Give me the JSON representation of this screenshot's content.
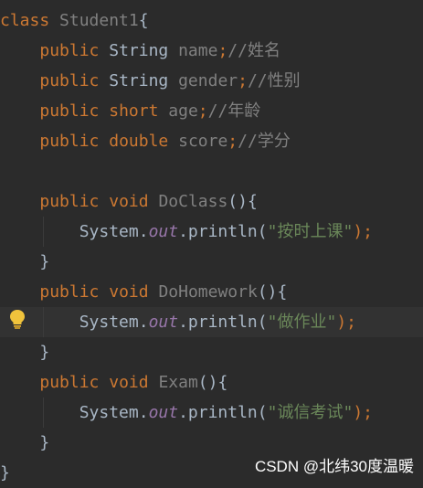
{
  "editor": {
    "lines": [
      {
        "tokens": [
          {
            "t": "class",
            "c": "kw"
          },
          {
            "t": " ",
            "c": ""
          },
          {
            "t": "Student1",
            "c": "unused"
          },
          {
            "t": "{",
            "c": ""
          }
        ]
      },
      {
        "tokens": [
          {
            "t": "    ",
            "c": ""
          },
          {
            "t": "public",
            "c": "kw"
          },
          {
            "t": " String ",
            "c": ""
          },
          {
            "t": "name",
            "c": "unused"
          },
          {
            "t": ";",
            "c": "kw"
          },
          {
            "t": "//姓名",
            "c": "comment"
          }
        ]
      },
      {
        "tokens": [
          {
            "t": "    ",
            "c": ""
          },
          {
            "t": "public",
            "c": "kw"
          },
          {
            "t": " String ",
            "c": ""
          },
          {
            "t": "gender",
            "c": "unused"
          },
          {
            "t": ";",
            "c": "kw"
          },
          {
            "t": "//性别",
            "c": "comment"
          }
        ]
      },
      {
        "tokens": [
          {
            "t": "    ",
            "c": ""
          },
          {
            "t": "public",
            "c": "kw"
          },
          {
            "t": " ",
            "c": ""
          },
          {
            "t": "short",
            "c": "kw"
          },
          {
            "t": " ",
            "c": ""
          },
          {
            "t": "age",
            "c": "unused"
          },
          {
            "t": ";",
            "c": "kw"
          },
          {
            "t": "//年龄",
            "c": "comment"
          }
        ]
      },
      {
        "tokens": [
          {
            "t": "    ",
            "c": ""
          },
          {
            "t": "public",
            "c": "kw"
          },
          {
            "t": " ",
            "c": ""
          },
          {
            "t": "double",
            "c": "kw"
          },
          {
            "t": " ",
            "c": ""
          },
          {
            "t": "score",
            "c": "unused"
          },
          {
            "t": ";",
            "c": "kw"
          },
          {
            "t": "//学分",
            "c": "comment"
          }
        ]
      },
      {
        "tokens": []
      },
      {
        "tokens": [
          {
            "t": "    ",
            "c": ""
          },
          {
            "t": "public",
            "c": "kw"
          },
          {
            "t": " ",
            "c": ""
          },
          {
            "t": "void",
            "c": "kw"
          },
          {
            "t": " ",
            "c": ""
          },
          {
            "t": "DoClass",
            "c": "unused"
          },
          {
            "t": "(){",
            "c": ""
          }
        ]
      },
      {
        "tokens": [
          {
            "t": "        System.",
            "c": ""
          },
          {
            "t": "out",
            "c": "out"
          },
          {
            "t": ".println(",
            "c": ""
          },
          {
            "t": "\"按时上课\"",
            "c": "str"
          },
          {
            "t": ");",
            "c": "kw"
          }
        ]
      },
      {
        "tokens": [
          {
            "t": "    }",
            "c": ""
          }
        ]
      },
      {
        "tokens": [
          {
            "t": "    ",
            "c": ""
          },
          {
            "t": "public",
            "c": "kw"
          },
          {
            "t": " ",
            "c": ""
          },
          {
            "t": "void",
            "c": "kw"
          },
          {
            "t": " ",
            "c": ""
          },
          {
            "t": "DoHomework",
            "c": "unused"
          },
          {
            "t": "(){",
            "c": ""
          }
        ]
      },
      {
        "tokens": [
          {
            "t": "        System.",
            "c": ""
          },
          {
            "t": "out",
            "c": "out"
          },
          {
            "t": ".println(",
            "c": ""
          },
          {
            "t": "\"做作业\"",
            "c": "str"
          },
          {
            "t": ");",
            "c": "kw"
          }
        ],
        "current": true
      },
      {
        "tokens": [
          {
            "t": "    }",
            "c": ""
          }
        ]
      },
      {
        "tokens": [
          {
            "t": "    ",
            "c": ""
          },
          {
            "t": "public",
            "c": "kw"
          },
          {
            "t": " ",
            "c": ""
          },
          {
            "t": "void",
            "c": "kw"
          },
          {
            "t": " ",
            "c": ""
          },
          {
            "t": "Exam",
            "c": "unused"
          },
          {
            "t": "(){",
            "c": ""
          }
        ]
      },
      {
        "tokens": [
          {
            "t": "        System.",
            "c": ""
          },
          {
            "t": "out",
            "c": "out"
          },
          {
            "t": ".println(",
            "c": ""
          },
          {
            "t": "\"诚信考试\"",
            "c": "str"
          },
          {
            "t": ");",
            "c": "kw"
          }
        ]
      },
      {
        "tokens": [
          {
            "t": "    }",
            "c": ""
          }
        ]
      },
      {
        "tokens": [
          {
            "t": "}",
            "c": ""
          }
        ]
      }
    ]
  },
  "icons": {
    "gutter": "lightbulb-icon"
  },
  "colors": {
    "background": "#2b2b2b",
    "current_line": "#323232",
    "keyword": "#cc7832",
    "text": "#a9b7c6",
    "unused": "#808080",
    "string": "#6a8759",
    "static_field": "#9876aa",
    "bulb": "#f0c33c"
  },
  "watermark": {
    "text": "CSDN @北纬30度温暖"
  }
}
